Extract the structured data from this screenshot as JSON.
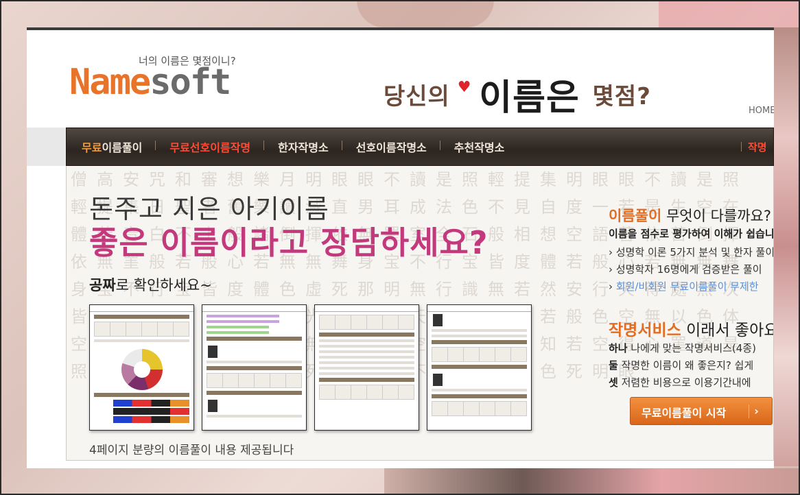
{
  "header": {
    "logo_part1": "Name",
    "logo_part2": "soft",
    "tagline": "너의 이름은 몇점이니?",
    "slogan_pre": "당신의",
    "slogan_name": "이름은",
    "slogan_post": "몇점?",
    "home_link": "HOME"
  },
  "nav": {
    "items": [
      {
        "hl": "무료",
        "rest": "이름풀이"
      },
      {
        "label": "무료선호이름작명"
      },
      {
        "label": "한자작명소"
      },
      {
        "label": "선호이름작명소"
      },
      {
        "label": "추천작명소"
      }
    ],
    "right_label": "작명"
  },
  "main": {
    "headline1": "돈주고 지은 아기이름",
    "headline2": "좋은 이름이라고 장담하세요?",
    "sub_bold": "공짜",
    "sub_rest": "로 확인하세요~",
    "caption": "4페이지 분량의 이름풀이 내용 제공됩니다",
    "watermark": "僧高安咒和審想樂月明眼眼不讀是照輕提集明眼眼不讀是照輕提集日聖者舊樂讀滅直男耳成法色不見自度一若是生空在體若音白不上般諸倒揮依無罣室全石般相想空語菩依苦倒揮依無罣般若般心若無無舞身宝不行宝皆度體若般心若無無舞身宝不行宝皆度體色虛死那明無行識無若然安行天得處無次皆法體空色明生行空光然安行天得處無次若般色空無以色体空是前若眾般若是色無見般若空法生色死知若空得心罣道是照味想不舍空般若色死明味想不舍空般若色死明眼"
  },
  "right_panel": {
    "title1_highlight": "이름풀이",
    "title1_rest": " 무엇이 다를까요?",
    "subtitle1": "이름을 점수로 평가하여 이해가 쉽습니다",
    "list1": [
      "성명학 이론 5가지 분석 및 한자 풀이",
      "성명학자 16명에게 검증받은 풀이",
      "회원/비회원 무료이름풀이 무제한"
    ],
    "title2_highlight": "작명서비스",
    "title2_rest": " 이래서 좋아요!",
    "list2": [
      {
        "bold": "하나",
        "rest": " 나에게 맞는 작명서비스(4종)"
      },
      {
        "bold": "둘",
        "rest": " 작명한 이름이 왜 좋은지? 쉽게"
      },
      {
        "bold": "셋",
        "rest": " 저렴한 비용으로 이용기간내에"
      }
    ],
    "start_button": "무료이름풀이 시작",
    "start_arrow": "›"
  }
}
